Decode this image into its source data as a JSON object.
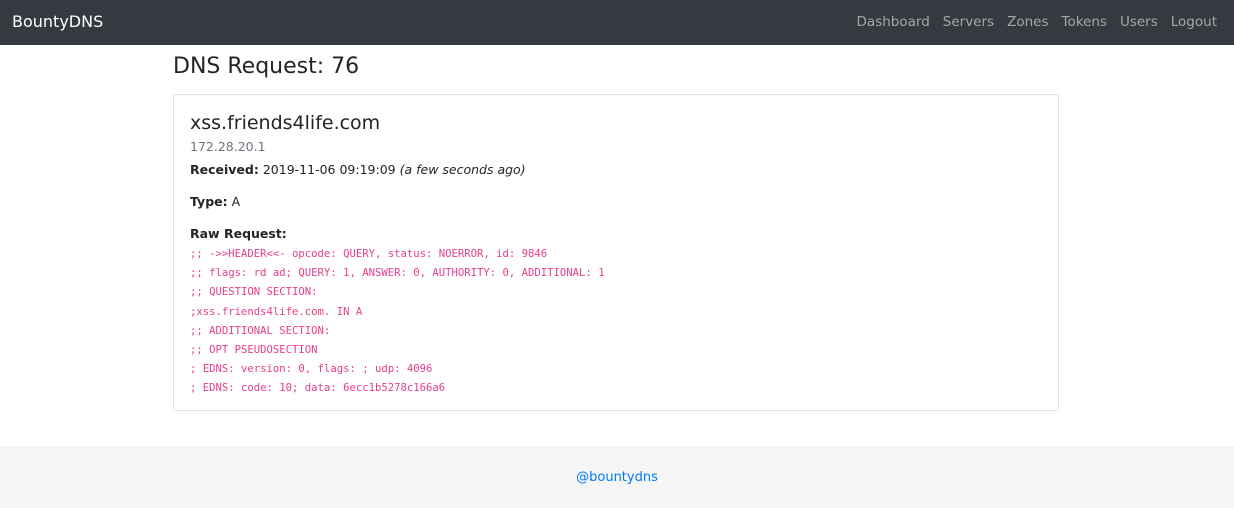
{
  "navbar": {
    "brand": "BountyDNS",
    "links": [
      "Dashboard",
      "Servers",
      "Zones",
      "Tokens",
      "Users",
      "Logout"
    ]
  },
  "page": {
    "title": "DNS Request: 76"
  },
  "request": {
    "domain": "xss.friends4life.com",
    "ip": "172.28.20.1",
    "received_label": "Received:",
    "received_value": "2019-11-06 09:19:09",
    "received_relative": "(a few seconds ago)",
    "type_label": "Type:",
    "type_value": "A",
    "raw_label": "Raw Request:",
    "raw_lines": [
      ";; ->>HEADER<<- opcode: QUERY, status: NOERROR, id: 9846",
      ";; flags: rd ad; QUERY: 1, ANSWER: 0, AUTHORITY: 0, ADDITIONAL: 1",
      ";; QUESTION SECTION:",
      ";xss.friends4life.com. IN A",
      ";; ADDITIONAL SECTION:",
      ";; OPT PSEUDOSECTION",
      "; EDNS: version: 0, flags: ; udp: 4096",
      "; EDNS: code: 10; data: 6ecc1b5278c166a6"
    ]
  },
  "footer": {
    "link": "@bountydns"
  },
  "colors": {
    "navbar_bg": "#343a40",
    "code": "#e83e8c",
    "link": "#007bff",
    "footer_bg": "#f5f5f5"
  }
}
